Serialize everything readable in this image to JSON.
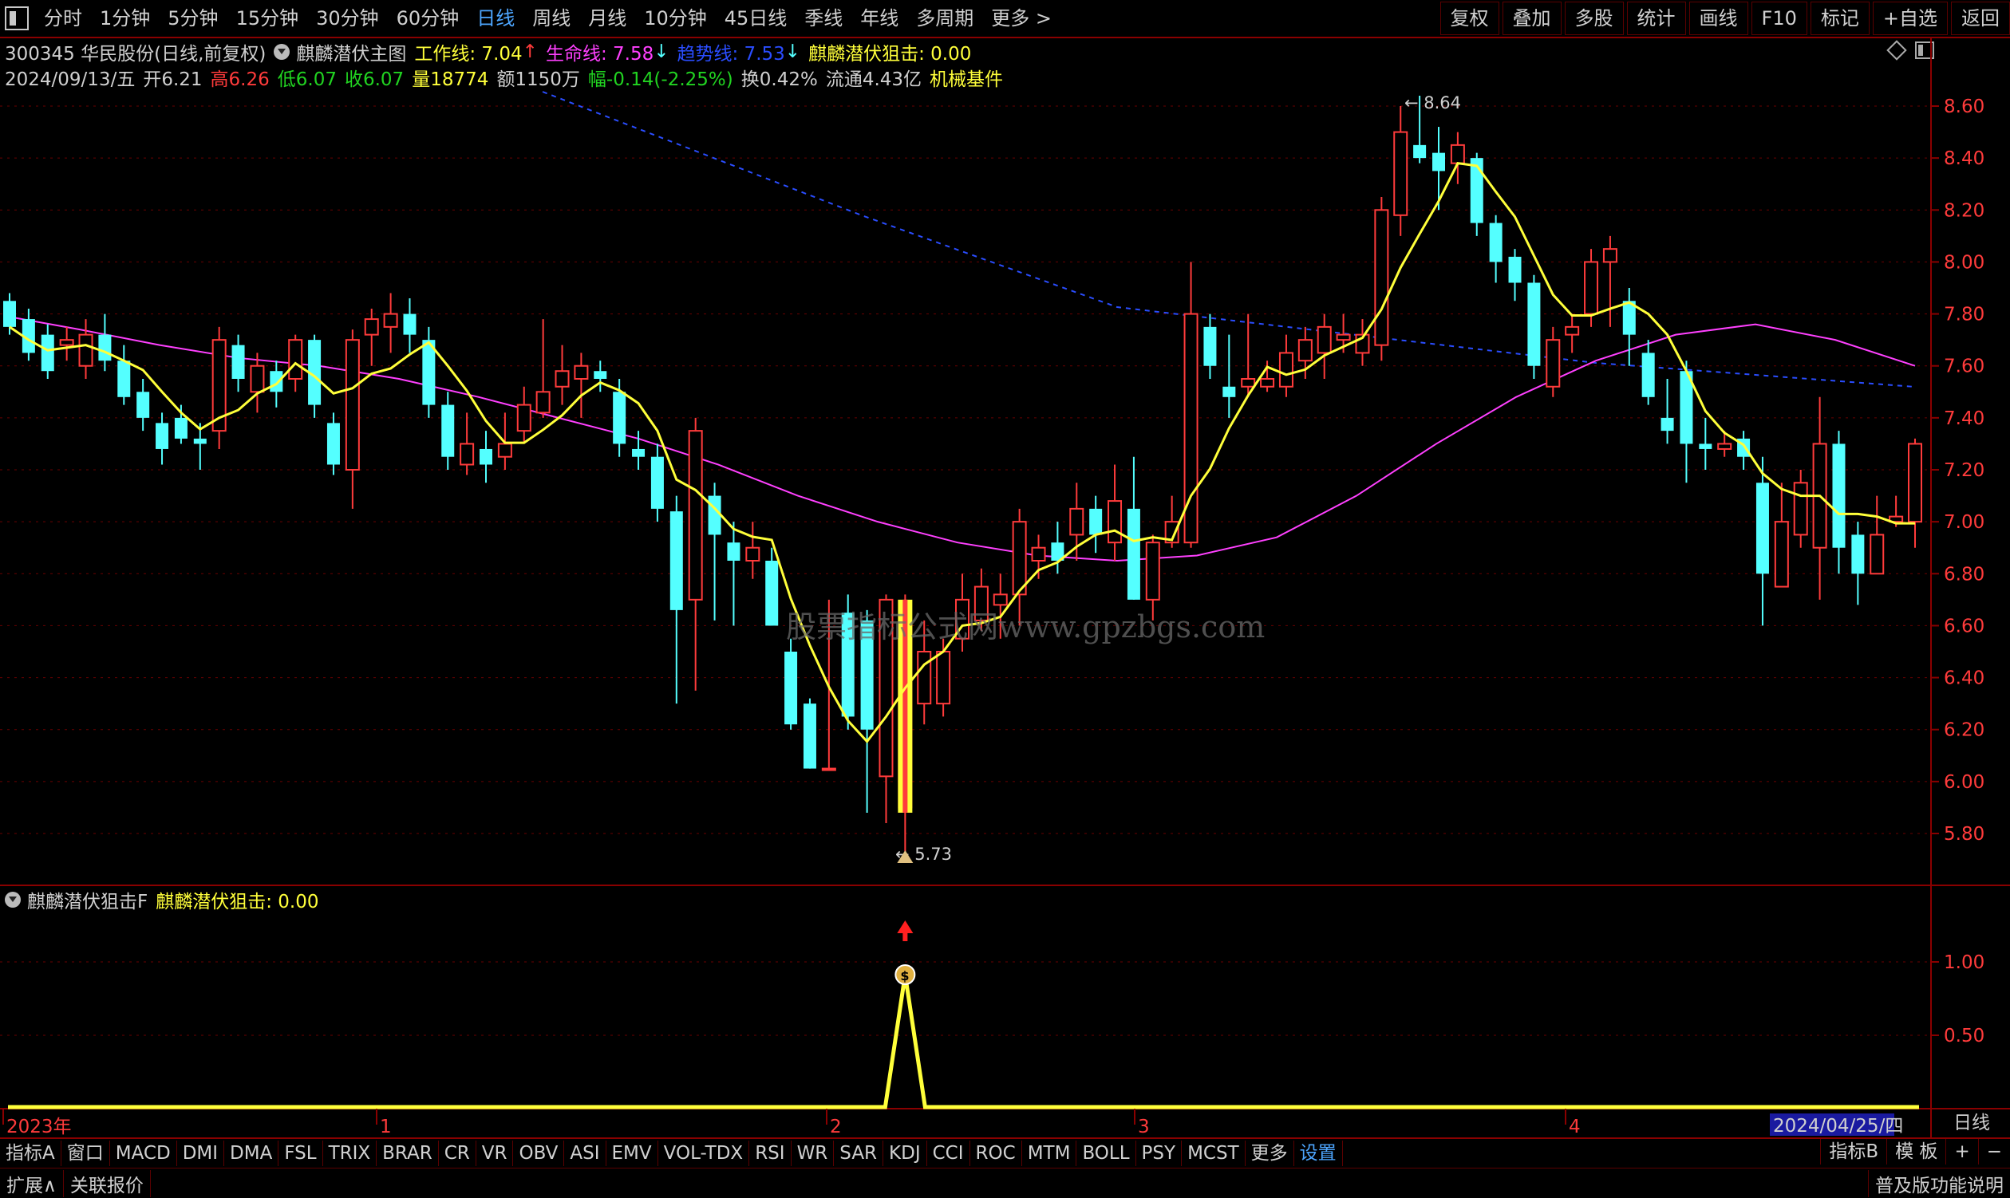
{
  "top_tabs": [
    "分时",
    "1分钟",
    "5分钟",
    "15分钟",
    "30分钟",
    "60分钟",
    "日线",
    "周线",
    "月线",
    "10分钟",
    "45日线",
    "季线",
    "年线",
    "多周期",
    "更多 >"
  ],
  "active_tab": "日线",
  "right_tabs": [
    "复权",
    "叠加",
    "多股",
    "统计",
    "画线",
    "F10",
    "标记",
    "+自选",
    "返回"
  ],
  "header": {
    "stock": "300345 华民股份(日线,前复权)",
    "indicator_name": "麒麟潜伏主图",
    "work_line_label": "工作线: 7.04",
    "work_arrow": "↑",
    "life_line_label": "生命线: 7.58",
    "life_arrow": "↓",
    "trend_line_label": "趋势线: 7.53",
    "trend_arrow": "↓",
    "strike_label": "麒麟潜伏狙击: 0.00"
  },
  "quote": {
    "date": "2024/09/13/五",
    "open": "开6.21",
    "high": "高6.26",
    "low": "低6.07",
    "close": "收6.07",
    "volume": "量18774",
    "amount": "额1150万",
    "change": "幅-0.14(-2.25%)",
    "turnover": "换0.42%",
    "float": "流通4.43亿",
    "sector": "机械基件"
  },
  "watermark": "股票指标公式网www.gpzbgs.com",
  "main_axis_ticks": [
    "8.60",
    "8.40",
    "8.20",
    "8.00",
    "7.80",
    "7.60",
    "7.40",
    "7.20",
    "7.00",
    "6.80",
    "6.60",
    "6.40",
    "6.20",
    "6.00",
    "5.80"
  ],
  "annotations": {
    "high": "8.64",
    "low": "5.73"
  },
  "indicator_panel": {
    "title": "麒麟潜伏狙击F",
    "value_label": "麒麟潜伏狙击: 0.00",
    "axis_ticks": [
      "1.00",
      "0.50"
    ]
  },
  "x_labels": [
    "2023年",
    "1",
    "2",
    "3",
    "4"
  ],
  "cursor_date": "2024/04/25/四",
  "period_label": "日线",
  "bottom_tabs": [
    "指标A",
    "窗口",
    "MACD",
    "DMI",
    "DMA",
    "FSL",
    "TRIX",
    "BRAR",
    "CR",
    "VR",
    "OBV",
    "ASI",
    "EMV",
    "VOL-TDX",
    "RSI",
    "WR",
    "SAR",
    "KDJ",
    "CCI",
    "ROC",
    "MTM",
    "BOLL",
    "PSY",
    "MCST",
    "更多",
    "设置"
  ],
  "active_bottom_tab": "设置",
  "bottom_right": [
    "指标B",
    "模 板",
    "+",
    "−"
  ],
  "status_left": [
    "扩展∧",
    "关联报价"
  ],
  "status_right": "普及版功能说明",
  "colors": {
    "up": "#ff3b3b",
    "down": "#54ffff",
    "work_line": "#ffff3a",
    "life_line": "#ff40ff",
    "trend_line": "#2a4dff",
    "signal": "#ffff3a",
    "grid": "#8a0000"
  },
  "chart_data": {
    "type": "candlestick",
    "ylim": [
      5.7,
      8.7
    ],
    "candles": [
      [
        7.85,
        7.75,
        7.88,
        7.72
      ],
      [
        7.78,
        7.65,
        7.82,
        7.62
      ],
      [
        7.72,
        7.58,
        7.76,
        7.55
      ],
      [
        7.68,
        7.7,
        7.75,
        7.62
      ],
      [
        7.6,
        7.72,
        7.78,
        7.55
      ],
      [
        7.72,
        7.62,
        7.8,
        7.58
      ],
      [
        7.62,
        7.48,
        7.68,
        7.45
      ],
      [
        7.5,
        7.4,
        7.55,
        7.35
      ],
      [
        7.38,
        7.28,
        7.42,
        7.22
      ],
      [
        7.4,
        7.32,
        7.45,
        7.3
      ],
      [
        7.32,
        7.3,
        7.38,
        7.2
      ],
      [
        7.35,
        7.7,
        7.75,
        7.28
      ],
      [
        7.68,
        7.55,
        7.72,
        7.5
      ],
      [
        7.5,
        7.6,
        7.65,
        7.42
      ],
      [
        7.58,
        7.5,
        7.62,
        7.44
      ],
      [
        7.55,
        7.7,
        7.72,
        7.5
      ],
      [
        7.7,
        7.45,
        7.72,
        7.4
      ],
      [
        7.38,
        7.22,
        7.42,
        7.18
      ],
      [
        7.2,
        7.7,
        7.74,
        7.05
      ],
      [
        7.72,
        7.78,
        7.82,
        7.6
      ],
      [
        7.75,
        7.8,
        7.88,
        7.65
      ],
      [
        7.8,
        7.72,
        7.86,
        7.65
      ],
      [
        7.7,
        7.45,
        7.75,
        7.4
      ],
      [
        7.45,
        7.25,
        7.5,
        7.2
      ],
      [
        7.22,
        7.3,
        7.42,
        7.18
      ],
      [
        7.28,
        7.22,
        7.35,
        7.15
      ],
      [
        7.25,
        7.3,
        7.42,
        7.2
      ],
      [
        7.35,
        7.45,
        7.52,
        7.3
      ],
      [
        7.42,
        7.5,
        7.78,
        7.4
      ],
      [
        7.52,
        7.58,
        7.68,
        7.45
      ],
      [
        7.55,
        7.6,
        7.65,
        7.4
      ],
      [
        7.58,
        7.55,
        7.62,
        7.5
      ],
      [
        7.5,
        7.3,
        7.55,
        7.25
      ],
      [
        7.28,
        7.25,
        7.35,
        7.2
      ],
      [
        7.25,
        7.05,
        7.3,
        7.0
      ],
      [
        7.04,
        6.66,
        7.1,
        6.3
      ],
      [
        6.7,
        7.35,
        7.4,
        6.35
      ],
      [
        7.1,
        6.95,
        7.15,
        6.62
      ],
      [
        6.92,
        6.85,
        7.0,
        6.6
      ],
      [
        6.85,
        6.9,
        7.0,
        6.78
      ],
      [
        6.85,
        6.6,
        6.9,
        6.6
      ],
      [
        6.5,
        6.22,
        6.55,
        6.2
      ],
      [
        6.3,
        6.05,
        6.32,
        6.05
      ],
      [
        6.05,
        6.05,
        6.7,
        6.05
      ],
      [
        6.65,
        6.25,
        6.72,
        6.2
      ],
      [
        6.62,
        6.2,
        6.66,
        5.88
      ],
      [
        6.02,
        6.7,
        6.72,
        5.84
      ],
      [
        5.9,
        6.6,
        6.72,
        5.73
      ],
      [
        6.3,
        6.5,
        6.62,
        6.22
      ],
      [
        6.3,
        6.5,
        6.55,
        6.25
      ],
      [
        6.55,
        6.7,
        6.8,
        6.5
      ],
      [
        6.62,
        6.75,
        6.82,
        6.58
      ],
      [
        6.68,
        6.72,
        6.8,
        6.55
      ],
      [
        6.72,
        7.0,
        7.05,
        6.6
      ],
      [
        6.85,
        6.9,
        6.95,
        6.78
      ],
      [
        6.92,
        6.85,
        7.0,
        6.8
      ],
      [
        6.95,
        7.05,
        7.15,
        6.85
      ],
      [
        7.05,
        6.95,
        7.1,
        6.88
      ],
      [
        6.92,
        7.08,
        7.22,
        6.85
      ],
      [
        7.05,
        6.7,
        7.25,
        6.7
      ],
      [
        6.7,
        6.92,
        6.95,
        6.62
      ],
      [
        6.92,
        7.0,
        7.1,
        6.9
      ],
      [
        6.92,
        7.8,
        8.0,
        6.9
      ],
      [
        7.75,
        7.6,
        7.8,
        7.55
      ],
      [
        7.52,
        7.48,
        7.72,
        7.4
      ],
      [
        7.52,
        7.55,
        7.8,
        7.48
      ],
      [
        7.52,
        7.55,
        7.62,
        7.5
      ],
      [
        7.52,
        7.65,
        7.72,
        7.48
      ],
      [
        7.62,
        7.7,
        7.75,
        7.55
      ],
      [
        7.65,
        7.75,
        7.8,
        7.55
      ],
      [
        7.7,
        7.72,
        7.8,
        7.65
      ],
      [
        7.65,
        7.72,
        7.78,
        7.6
      ],
      [
        7.68,
        8.2,
        8.25,
        7.62
      ],
      [
        8.18,
        8.5,
        8.6,
        8.1
      ],
      [
        8.45,
        8.4,
        8.64,
        8.38
      ],
      [
        8.42,
        8.35,
        8.52,
        8.2
      ],
      [
        8.38,
        8.45,
        8.5,
        8.3
      ],
      [
        8.4,
        8.15,
        8.42,
        8.1
      ],
      [
        8.15,
        8.0,
        8.18,
        7.92
      ],
      [
        8.02,
        7.92,
        8.05,
        7.85
      ],
      [
        7.92,
        7.6,
        7.95,
        7.55
      ],
      [
        7.52,
        7.7,
        7.75,
        7.48
      ],
      [
        7.72,
        7.75,
        7.8,
        7.65
      ],
      [
        7.8,
        8.0,
        8.05,
        7.75
      ],
      [
        8.0,
        8.05,
        8.1,
        7.75
      ],
      [
        7.85,
        7.72,
        7.9,
        7.6
      ],
      [
        7.65,
        7.48,
        7.7,
        7.45
      ],
      [
        7.4,
        7.35,
        7.55,
        7.3
      ],
      [
        7.58,
        7.3,
        7.62,
        7.15
      ],
      [
        7.3,
        7.28,
        7.4,
        7.2
      ],
      [
        7.28,
        7.3,
        7.35,
        7.25
      ],
      [
        7.32,
        7.25,
        7.35,
        7.2
      ],
      [
        7.15,
        6.8,
        7.25,
        6.6
      ],
      [
        6.75,
        7.0,
        7.15,
        6.75
      ],
      [
        6.95,
        7.15,
        7.2,
        6.9
      ],
      [
        6.9,
        7.3,
        7.48,
        6.7
      ],
      [
        7.3,
        6.9,
        7.35,
        6.8
      ],
      [
        6.95,
        6.8,
        7.0,
        6.68
      ],
      [
        6.8,
        6.95,
        7.1,
        6.8
      ],
      [
        7.0,
        7.02,
        7.1,
        6.98
      ],
      [
        7.0,
        7.3,
        7.32,
        6.9
      ]
    ],
    "signal_index": 47,
    "signal_values": [
      0,
      1,
      0
    ]
  }
}
